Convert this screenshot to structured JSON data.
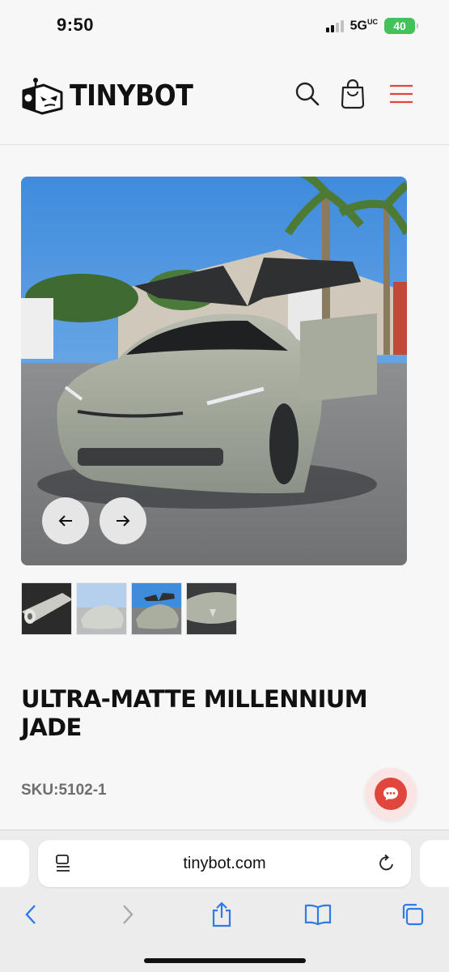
{
  "status_bar": {
    "time": "9:50",
    "network": "5G",
    "network_suffix": "UC",
    "battery": "40"
  },
  "header": {
    "brand": "TINYBOT",
    "icons": [
      "logo-robot-icon",
      "search-icon",
      "shopping-bag-icon",
      "hamburger-menu-icon"
    ],
    "accent_color": "#e0463c"
  },
  "gallery": {
    "thumbnail_count": 4,
    "prev_icon": "arrow-left-icon",
    "next_icon": "arrow-right-icon"
  },
  "product": {
    "title": "ULTRA-MATTE MILLENNIUM JADE",
    "sku_label": "SKU:",
    "sku": "5102-1"
  },
  "chat": {
    "icon": "chat-bubble-icon",
    "color": "#e0463c"
  },
  "browser": {
    "url": "tinybot.com",
    "toolbar_icons": [
      "back-icon",
      "forward-icon",
      "share-icon",
      "bookmarks-icon",
      "tabs-icon"
    ]
  }
}
